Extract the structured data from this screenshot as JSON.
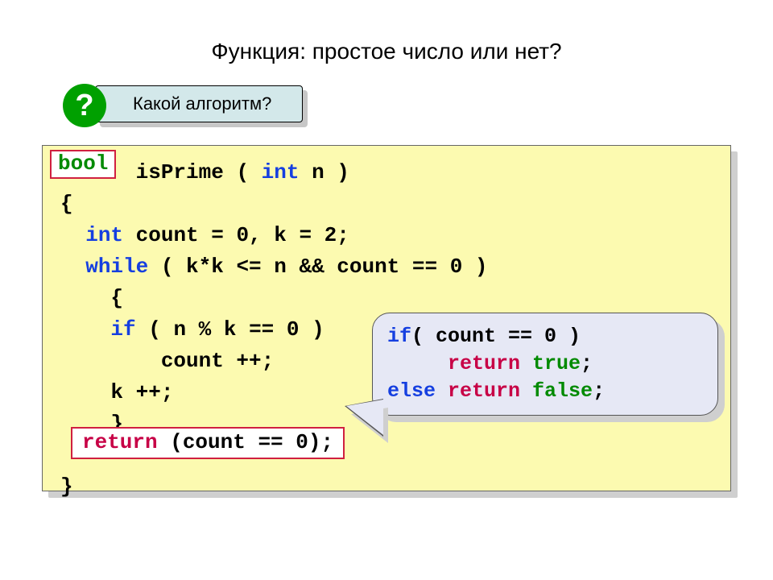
{
  "title": "Функция: простое число или нет?",
  "header": {
    "q": "?",
    "text": "Какой алгоритм?"
  },
  "bool_badge": "bool",
  "code": {
    "l1_prefix_space": "     ",
    "l1_fn": "isPrime",
    "l1_paren_open": "(",
    "l1_int": " int",
    "l1_n": " n ",
    "l1_paren_close": ")",
    "l2": "{",
    "l3_indent": "  ",
    "l3_int": "int",
    "l3_rest": " count = 0, k = 2;",
    "l4_indent": "  ",
    "l4_while": "while",
    "l4_rest": " ( k*k <= n && count == 0 )",
    "l5": "    {",
    "l6_indent": "    ",
    "l6_if": "if",
    "l6_rest": " ( n % k == 0 )",
    "l7": "        count ++;",
    "l8": "    k ++;",
    "l9": "    }",
    "l10_blank": " ",
    "l11": "}"
  },
  "return_badge": {
    "ret": "return",
    "rest": " (count == 0);"
  },
  "bubble": {
    "l1_if": "if",
    "l1_rest": "( count == 0 )",
    "l2_indent": "     ",
    "l2_ret": "return",
    "l2_true": " true",
    "l2_semi": ";",
    "l3_else": "else",
    "l3_ret": " return",
    "l3_false": " false",
    "l3_semi": ";"
  }
}
